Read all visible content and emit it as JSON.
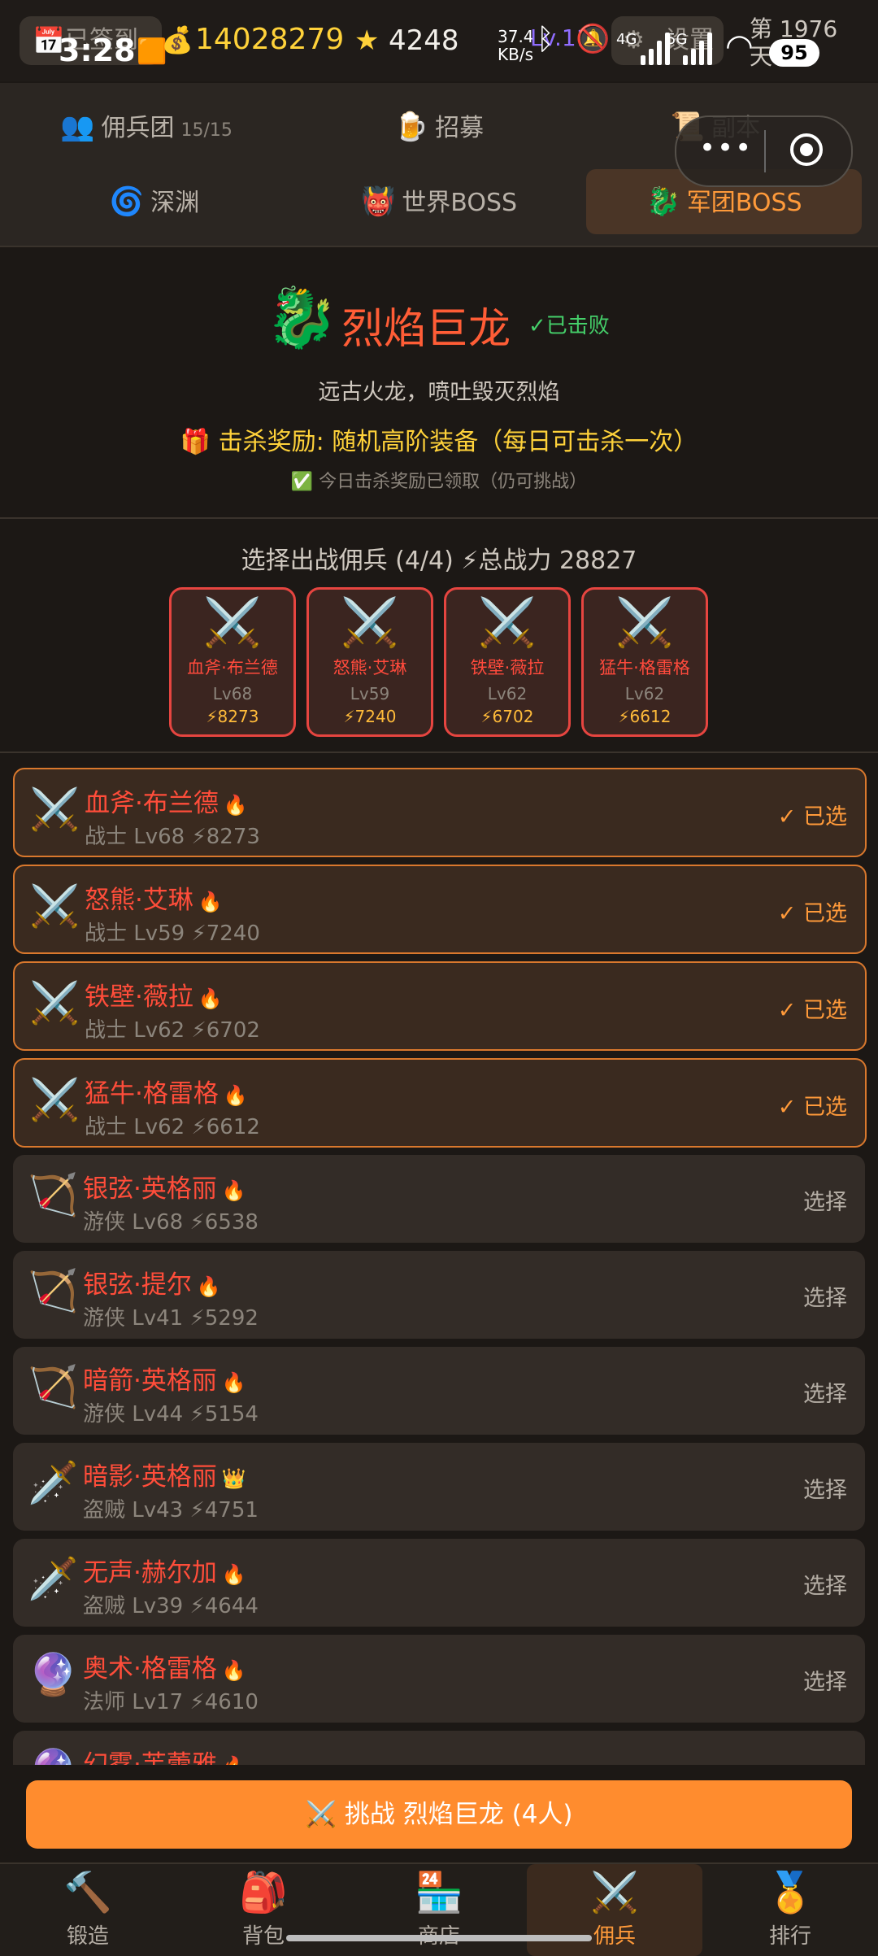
{
  "status": {
    "time": "3:28",
    "checkin_label": "已签到",
    "gold": "14028279",
    "stars": "4248",
    "level_label": "Lv.11",
    "net_speed_top": "37.4",
    "net_speed_unit": "KB/s",
    "settings_label": "设置",
    "day_label": "第 1976",
    "day_suffix": "天",
    "battery": "95",
    "net1": "4G",
    "net2": "5G"
  },
  "tabs": {
    "row1": [
      {
        "icon": "👥",
        "label": "佣兵团",
        "count": "15/15"
      },
      {
        "icon": "🍺",
        "label": "招募"
      },
      {
        "icon": "📜",
        "label": "副本"
      }
    ],
    "row2": [
      {
        "icon": "🌀",
        "label": "深渊"
      },
      {
        "icon": "👹",
        "label": "世界BOSS"
      },
      {
        "icon": "🐉",
        "label": "军团BOSS"
      }
    ]
  },
  "boss": {
    "icon": "🐉",
    "name": "烈焰巨龙",
    "status": "✓已击败",
    "description": "远古火龙，喷吐毁灭烈焰",
    "reward": "🎁 击杀奖励: 随机高阶装备（每日可击杀一次）",
    "claimed_note": "✅ 今日击杀奖励已领取（仍可挑战）"
  },
  "squad": {
    "header": "选择出战佣兵 (4/4) ⚡总战力 28827",
    "slots": [
      {
        "icon": "⚔️",
        "name": "血斧·布兰德",
        "level": "Lv68",
        "power": "⚡8273"
      },
      {
        "icon": "⚔️",
        "name": "怒熊·艾琳",
        "level": "Lv59",
        "power": "⚡7240"
      },
      {
        "icon": "⚔️",
        "name": "铁壁·薇拉",
        "level": "Lv62",
        "power": "⚡6702"
      },
      {
        "icon": "⚔️",
        "name": "猛牛·格雷格",
        "level": "Lv62",
        "power": "⚡6612"
      }
    ]
  },
  "mercenaries": [
    {
      "icon": "⚔️",
      "name": "血斧·布兰德",
      "badge": "🔥",
      "sub": "战士 Lv68 ⚡8273",
      "action": "✓ 已选",
      "selected": true
    },
    {
      "icon": "⚔️",
      "name": "怒熊·艾琳",
      "badge": "🔥",
      "sub": "战士 Lv59 ⚡7240",
      "action": "✓ 已选",
      "selected": true
    },
    {
      "icon": "⚔️",
      "name": "铁壁·薇拉",
      "badge": "🔥",
      "sub": "战士 Lv62 ⚡6702",
      "action": "✓ 已选",
      "selected": true
    },
    {
      "icon": "⚔️",
      "name": "猛牛·格雷格",
      "badge": "🔥",
      "sub": "战士 Lv62 ⚡6612",
      "action": "✓ 已选",
      "selected": true
    },
    {
      "icon": "🏹",
      "name": "银弦·英格丽",
      "badge": "🔥",
      "sub": "游侠 Lv68 ⚡6538",
      "action": "选择",
      "selected": false
    },
    {
      "icon": "🏹",
      "name": "银弦·提尔",
      "badge": "🔥",
      "sub": "游侠 Lv41 ⚡5292",
      "action": "选择",
      "selected": false
    },
    {
      "icon": "🏹",
      "name": "暗箭·英格丽",
      "badge": "🔥",
      "sub": "游侠 Lv44 ⚡5154",
      "action": "选择",
      "selected": false
    },
    {
      "icon": "🗡️",
      "name": "暗影·英格丽",
      "badge": "👑",
      "sub": "盗贼 Lv43 ⚡4751",
      "action": "选择",
      "selected": false
    },
    {
      "icon": "🗡️",
      "name": "无声·赫尔加",
      "badge": "🔥",
      "sub": "盗贼 Lv39 ⚡4644",
      "action": "选择",
      "selected": false
    },
    {
      "icon": "🔮",
      "name": "奥术·格雷格",
      "badge": "🔥",
      "sub": "法师 Lv17 ⚡4610",
      "action": "选择",
      "selected": false
    },
    {
      "icon": "🔮",
      "name": "幻雾·芙蕾雅",
      "badge": "🔥",
      "sub": "",
      "action": "",
      "selected": false
    }
  ],
  "challenge_button": "⚔️ 挑战 烈焰巨龙 (4人)",
  "nav": [
    {
      "icon": "🔨",
      "label": "锻造"
    },
    {
      "icon": "🎒",
      "label": "背包"
    },
    {
      "icon": "🏪",
      "label": "商店"
    },
    {
      "icon": "⚔️",
      "label": "佣兵"
    },
    {
      "icon": "🏅",
      "label": "排行"
    }
  ]
}
